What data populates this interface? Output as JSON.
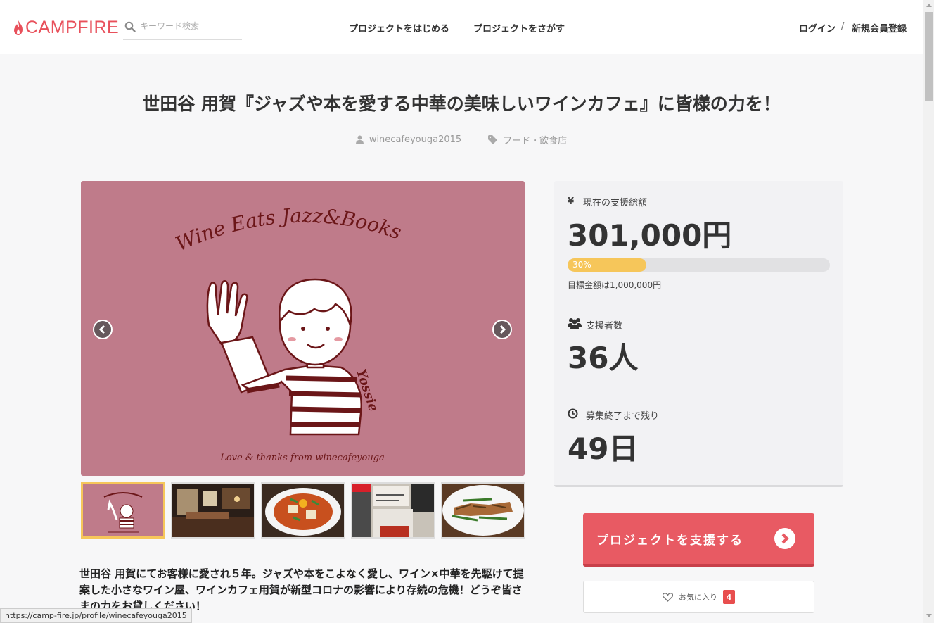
{
  "header": {
    "logo_text": "CAMPFIRE",
    "search_placeholder": "キーワード検索",
    "nav_start": "プロジェクトをはじめる",
    "nav_find": "プロジェクトをさがす",
    "login": "ログイン",
    "separator": "/",
    "signup": "新規会員登録"
  },
  "project": {
    "title": "世田谷 用賀『ジャズや本を愛する中華の美味しいワインカフェ』に皆様の力を！",
    "owner": "winecafeyouga2015",
    "category": "フード・飲食店",
    "image_heading": "Wine Eats Jazz&Books",
    "image_signature": "Yossie",
    "image_footer": "Love & thanks from winecafeyouga",
    "description": "世田谷 用賀にてお客様に愛され５年。ジャズや本をこよなく愛し、ワイン×中華を先駆けて提案した小さなワイン屋、ワインカフェ用賀が新型コロナの影響により存続の危機！どうぞ皆さまの力をお貸しください！"
  },
  "stats": {
    "amount_label": "現在の支援総額",
    "amount_icon": "yen-icon",
    "amount": "301,000円",
    "progress_percent": 30,
    "progress_text": "30%",
    "goal": "目標金額は1,000,000円",
    "backers_label": "支援者数",
    "backers": "36人",
    "remaining_label": "募集終了まで残り",
    "remaining": "49日"
  },
  "actions": {
    "support_label": "プロジェクトを支援する",
    "favorite_label": "お気に入り",
    "favorite_count": "4"
  },
  "statusbar": {
    "url": "https://camp-fire.jp/profile/winecafeyouga2015"
  },
  "colors": {
    "brand": "#e8505b",
    "progress": "#f6c65a",
    "image_bg": "#bf7b8a",
    "badge": "#e84e4e"
  }
}
